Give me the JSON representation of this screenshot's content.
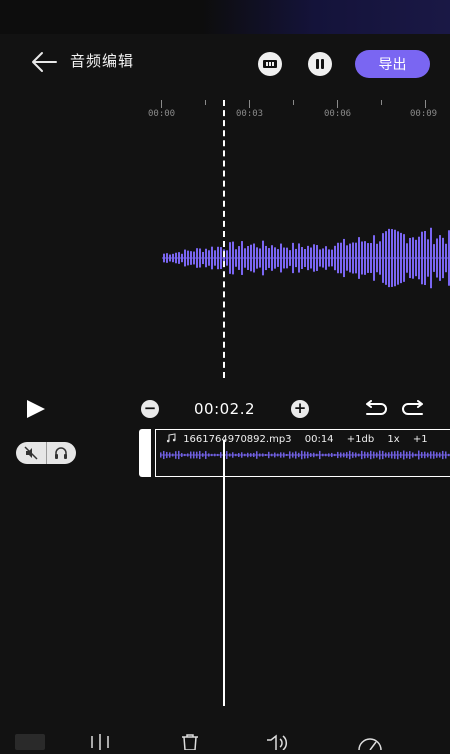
{
  "header": {
    "title": "音频编辑",
    "export_label": "导出",
    "accent_color": "#7a66f2"
  },
  "ruler": {
    "labels": [
      "00:00",
      "00:03",
      "00:06",
      "00:09"
    ]
  },
  "controls": {
    "current_time": "00:02.2",
    "minus_symbol": "−",
    "plus_symbol": "+"
  },
  "clip": {
    "filename": "1661764970892.mp3",
    "duration": "00:14",
    "volume": "+1db",
    "speed": "1x",
    "extra": "+1"
  },
  "icons": {
    "back": "back-arrow-icon",
    "split_view": "split-view-icon",
    "pause_bars": "pause-bars-icon",
    "play": "play-icon",
    "undo": "undo-icon",
    "redo": "redo-icon",
    "mute": "mute-icon",
    "headphone": "headphone-icon",
    "music_note": "music-note-icon"
  }
}
